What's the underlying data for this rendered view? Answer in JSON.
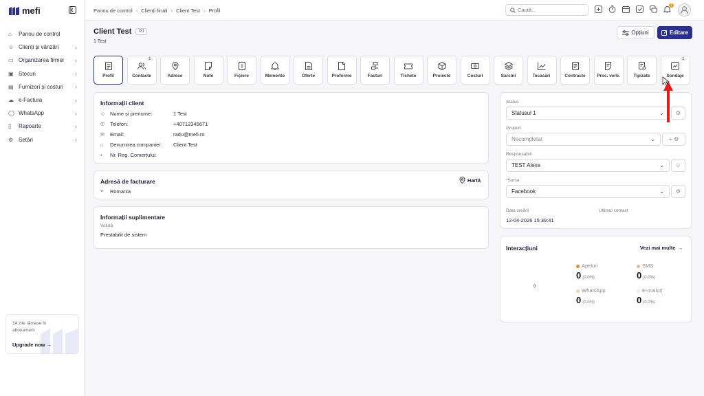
{
  "app": {
    "name": "mefi"
  },
  "sidebar": {
    "items": [
      {
        "label": "Panou de control",
        "icon": "home-icon",
        "chev": ""
      },
      {
        "label": "Clienți și vânzări",
        "icon": "users-icon",
        "chev": "›"
      },
      {
        "label": "Organizarea firmei",
        "icon": "briefcase-icon",
        "chev": "›"
      },
      {
        "label": "Stocuri",
        "icon": "box-icon",
        "chev": "›"
      },
      {
        "label": "Furnizori și costuri",
        "icon": "folder-icon",
        "chev": "›"
      },
      {
        "label": "e-Factura",
        "icon": "cloud-icon",
        "chev": "›"
      },
      {
        "label": "WhatsApp",
        "icon": "chat-icon",
        "chev": "›"
      },
      {
        "label": "Rapoarte",
        "icon": "clipboard-icon",
        "chev": "›"
      },
      {
        "label": "Setări",
        "icon": "gear-icon",
        "chev": "›"
      }
    ]
  },
  "upgrade": {
    "text": "14 zile rămase în abonament",
    "button": "Upgrade now"
  },
  "breadcrumb": [
    "Panou de control",
    "Clienți finali",
    "Client Test",
    "Profil"
  ],
  "search": {
    "placeholder": "Caută..."
  },
  "notifications": {
    "badge": "1"
  },
  "client": {
    "name": "Client Test",
    "type": "PJ",
    "subtitle": "1 Test"
  },
  "actions": {
    "options": "Opțiuni",
    "edit": "Editare"
  },
  "tabs": [
    {
      "label": "Profil",
      "icon": "profile-icon",
      "count": ""
    },
    {
      "label": "Contacte",
      "icon": "contacts-icon",
      "count": "1"
    },
    {
      "label": "Adrese",
      "icon": "pin-icon",
      "count": ""
    },
    {
      "label": "Note",
      "icon": "note-icon",
      "count": ""
    },
    {
      "label": "Fișiere",
      "icon": "file-icon",
      "count": ""
    },
    {
      "label": "Memento",
      "icon": "bell-icon",
      "count": ""
    },
    {
      "label": "Oferte",
      "icon": "offer-icon",
      "count": ""
    },
    {
      "label": "Proforme",
      "icon": "doc-icon",
      "count": ""
    },
    {
      "label": "Facturi",
      "icon": "invoice-icon",
      "count": ""
    },
    {
      "label": "Tichete",
      "icon": "ticket-icon",
      "count": ""
    },
    {
      "label": "Proiecte",
      "icon": "cube-icon",
      "count": ""
    },
    {
      "label": "Costuri",
      "icon": "cost-icon",
      "count": ""
    },
    {
      "label": "Sarcini",
      "icon": "layers-icon",
      "count": ""
    },
    {
      "label": "Încasări",
      "icon": "chart-line-icon",
      "count": ""
    },
    {
      "label": "Contracte",
      "icon": "contract-icon",
      "count": ""
    },
    {
      "label": "Proc. verb.",
      "icon": "minutes-icon",
      "count": ""
    },
    {
      "label": "Tipizate",
      "icon": "form-icon",
      "count": ""
    },
    {
      "label": "Sondaje",
      "icon": "survey-icon",
      "count": "1"
    }
  ],
  "info": {
    "title": "Informații client",
    "rows": [
      {
        "key": "Nume și prenume:",
        "value": "1 Test",
        "icon": "user-icon"
      },
      {
        "key": "Telefon:",
        "value": "+40712345671",
        "icon": "phone-icon"
      },
      {
        "key": "Email:",
        "value": "radu@mefi.ro",
        "icon": "mail-icon"
      },
      {
        "key": "Denumirea companiei:",
        "value": "Client Test",
        "icon": "bank-icon"
      },
      {
        "key": "Nr. Reg. Comerțului:",
        "value": "",
        "icon": "hash-icon"
      }
    ]
  },
  "billing": {
    "title": "Adresă de facturare",
    "map": "Hartă",
    "address": "Romania"
  },
  "extra": {
    "title": "Informații suplimentare",
    "label": "Volută",
    "value": "Prestabilit de sistem"
  },
  "status_panel": {
    "status_label": "Status",
    "status_value": "Statusul 1",
    "groups_label": "Grupuri",
    "groups_value": "Necompletat",
    "resp_label": "Responsabili",
    "resp_value": "TEST Alexe",
    "source_label": "*Sursa",
    "source_value": "Facebook",
    "created_label": "Data creării",
    "created_value": "12-04-2026 15:39:41",
    "last_contact_label": "Ultimul contact",
    "last_contact_value": ""
  },
  "interactions": {
    "title": "Interacțiuni",
    "more": "Vezi mai multe",
    "center": "0",
    "stats": [
      {
        "label": "Apeluri",
        "value": "0",
        "pct": "(0.0%)",
        "color": "#e08a3c"
      },
      {
        "label": "SMS",
        "value": "0",
        "pct": "(0.0%)",
        "color": "#f2b98f"
      },
      {
        "label": "WhatsApp",
        "value": "0",
        "pct": "(0.0%)",
        "color": "#f5cfae"
      },
      {
        "label": "E-mailuri",
        "value": "0",
        "pct": "(0.0%)",
        "color": "#f6f0ea"
      }
    ]
  },
  "colors": {
    "accent": "#2b2f8e",
    "arrow": "#e41b1b"
  }
}
